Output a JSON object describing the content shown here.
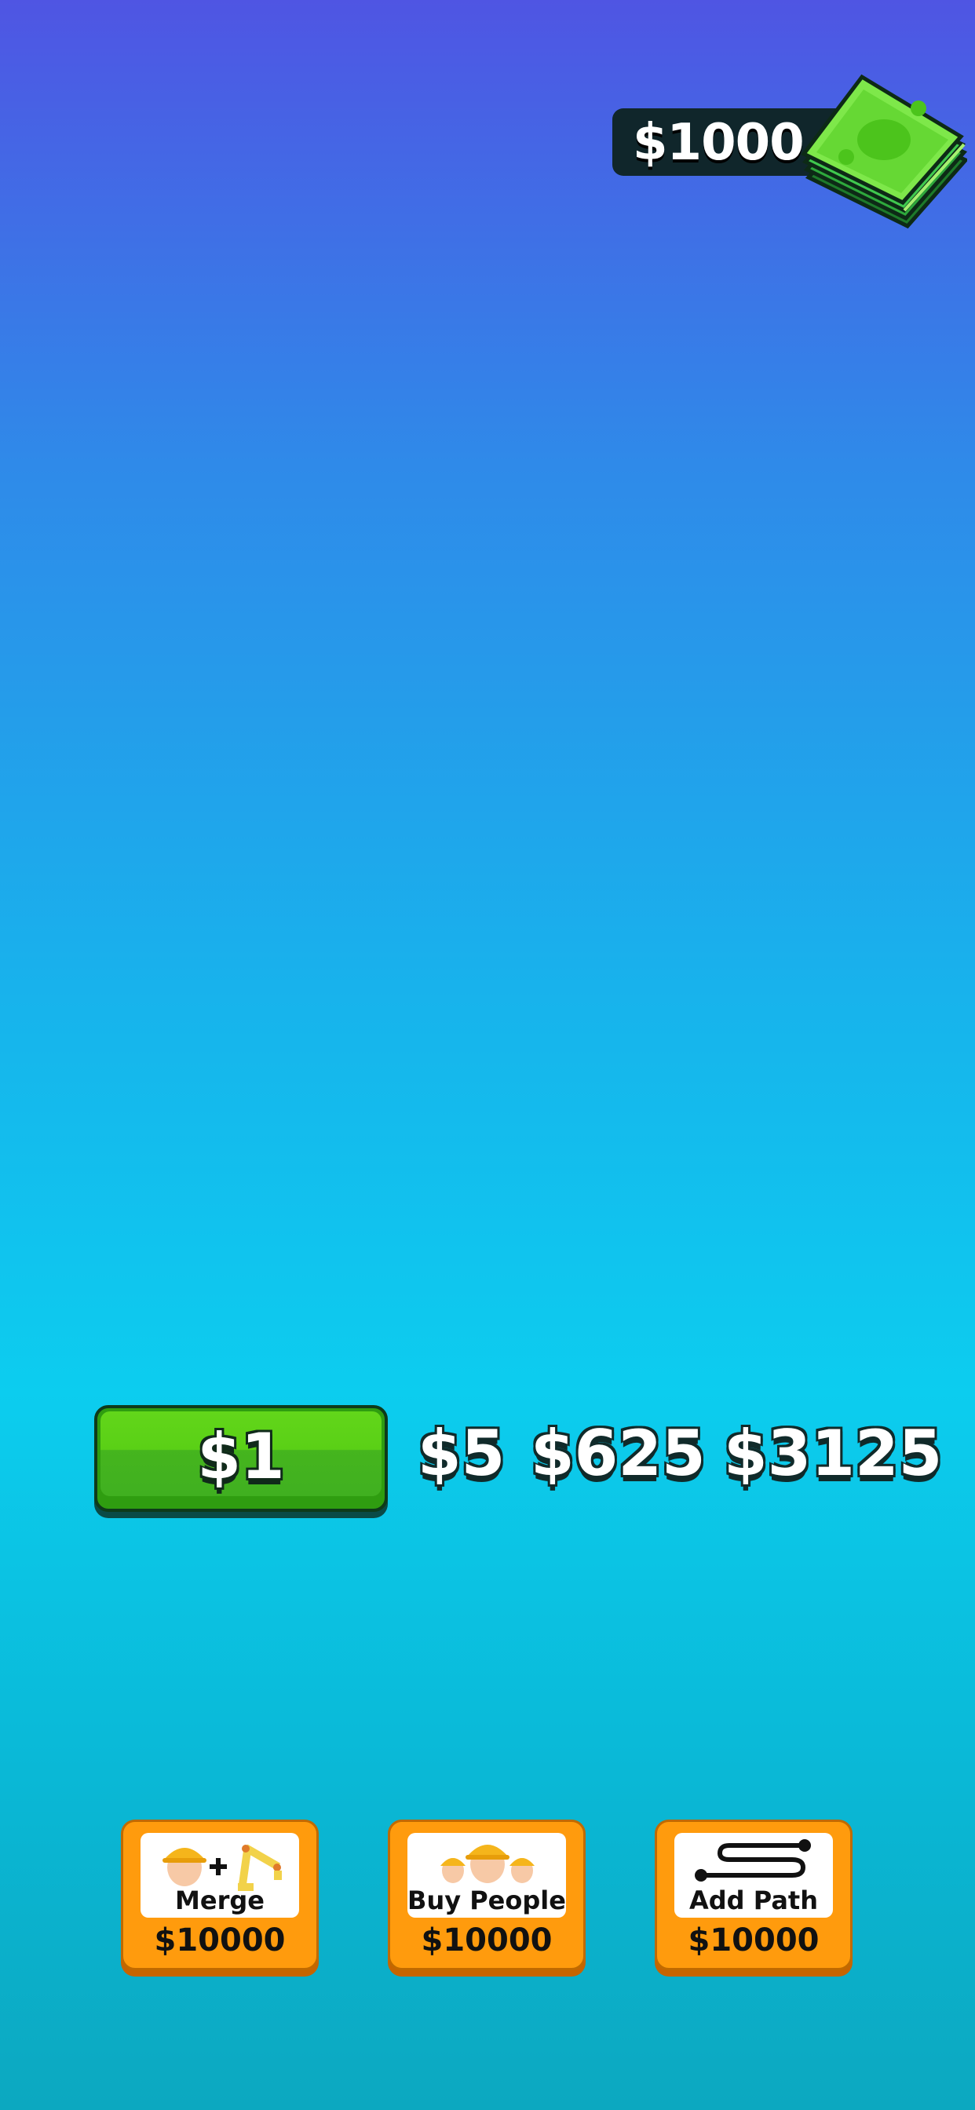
{
  "hud": {
    "money": "$1000",
    "money_icon": "cash-stack-icon"
  },
  "value_row": {
    "current_value": "$1",
    "tiers": [
      "$5",
      "$625",
      "$3125"
    ]
  },
  "shop": {
    "merge": {
      "label": "Merge",
      "price": "$10000",
      "icon": "worker-plus-robot-arm-icon"
    },
    "buy_people": {
      "label": "Buy People",
      "price": "$10000",
      "icon": "workers-icon"
    },
    "add_path": {
      "label": "Add Path",
      "price": "$10000",
      "icon": "path-icon"
    }
  },
  "colors": {
    "green_button": "#5ad016",
    "orange_button": "#ff9b0d",
    "money_pill": "#10262b"
  }
}
